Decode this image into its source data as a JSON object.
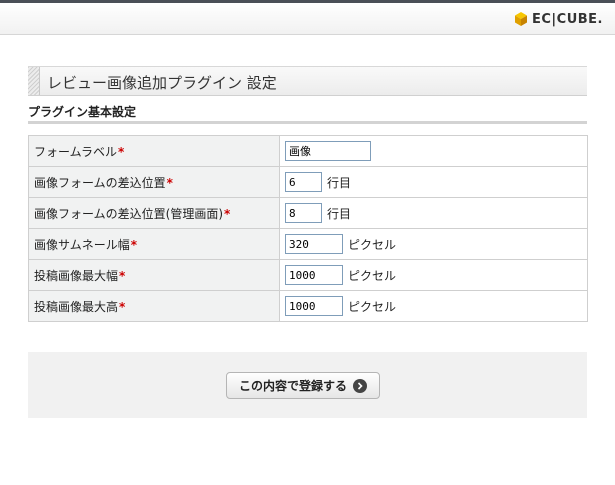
{
  "header": {
    "logo_text": "EC|CUBE."
  },
  "page": {
    "title": "レビュー画像追加プラグイン 設定",
    "subtitle": "プラグイン基本設定"
  },
  "form": {
    "required_mark": "*",
    "rows": [
      {
        "label": "フォームラベル",
        "value": "画像",
        "unit": ""
      },
      {
        "label": "画像フォームの差込位置",
        "value": "6",
        "unit": "行目"
      },
      {
        "label": "画像フォームの差込位置(管理画面)",
        "value": "8",
        "unit": "行目"
      },
      {
        "label": "画像サムネール幅",
        "value": "320",
        "unit": "ピクセル"
      },
      {
        "label": "投稿画像最大幅",
        "value": "1000",
        "unit": "ピクセル"
      },
      {
        "label": "投稿画像最大高",
        "value": "1000",
        "unit": "ピクセル"
      }
    ]
  },
  "actions": {
    "submit_label": "この内容で登録する",
    "submit_icon": "arrow-right-circle-icon"
  },
  "colors": {
    "required": "#cc0000",
    "topline": "#4a4f57",
    "logo_accent": "#f0b400"
  }
}
